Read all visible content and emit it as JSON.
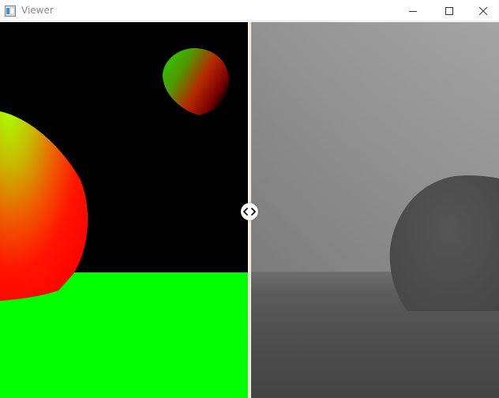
{
  "window": {
    "title": "Viewer",
    "controls": [
      "minimize",
      "maximize",
      "close"
    ]
  },
  "icons": {
    "app": "app-window-icon",
    "minimize": "minimize-icon",
    "maximize": "maximize-icon",
    "close": "close-icon",
    "splitter": "split-arrows-icon"
  },
  "viewer": {
    "left_view": "normals-color-render",
    "right_view": "depth-grayscale-render",
    "split_position": 0.5
  },
  "colors": {
    "floor_green": "#00ff00",
    "background_black": "#000000",
    "depth_near": "#434343",
    "depth_far": "#9a9a9a",
    "divider": "#fff8f0"
  }
}
